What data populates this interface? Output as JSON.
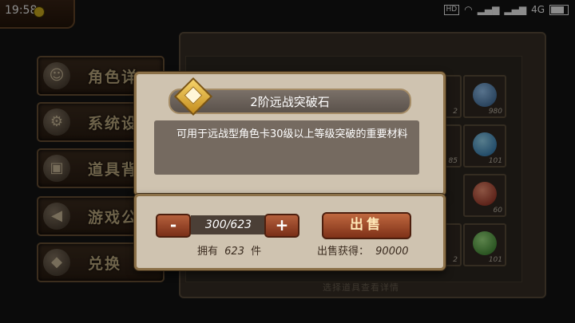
{
  "status_bar": {
    "time": "19:58",
    "hd": "HD",
    "network": "4G"
  },
  "side_menu": {
    "items": [
      {
        "label": "角色详",
        "icon": "character-icon"
      },
      {
        "label": "系统设",
        "icon": "gear-icon"
      },
      {
        "label": "道具背",
        "icon": "bag-icon"
      },
      {
        "label": "游戏公",
        "icon": "megaphone-icon"
      },
      {
        "label": "兑换",
        "icon": "gift-icon"
      }
    ]
  },
  "inventory": {
    "counts": [
      "980",
      "101",
      "60",
      "101"
    ],
    "partial_counts": [
      "2",
      "85",
      "2"
    ],
    "hint": "选择道具查看详情"
  },
  "item_dialog": {
    "title": "2阶远战突破石",
    "description": "可用于远战型角色卡30级以上等级突破的重要材料"
  },
  "sell_panel": {
    "minus_label": "-",
    "plus_label": "+",
    "quantity": "300/623",
    "sell_label": "出售",
    "own_label": "拥有",
    "own_count": "623",
    "own_unit": "件",
    "earn_label": "出售获得：",
    "earn_value": "90000"
  },
  "colors": {
    "accent_button": "#a34a26",
    "panel": "#cfc3b0",
    "frame": "#8b7048"
  }
}
